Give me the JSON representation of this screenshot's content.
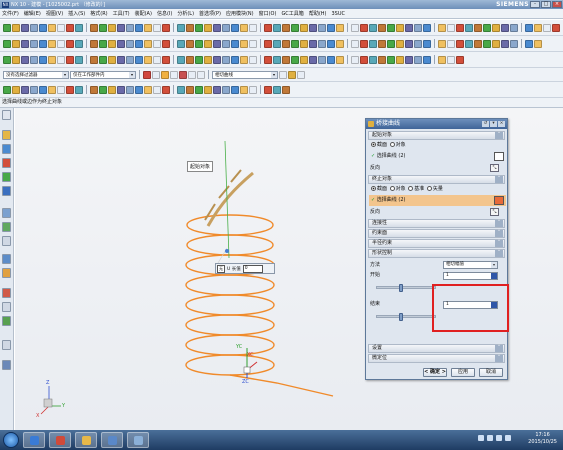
{
  "window": {
    "app_logo": "NX",
    "title": "NX 10 - 建模 - [1025002.prt （修改的）]",
    "brand": "SIEMENS",
    "buttons": [
      "-",
      "□",
      "×"
    ]
  },
  "menu": [
    "文件(F)",
    "编辑(E)",
    "视图(V)",
    "插入(S)",
    "格式(R)",
    "工具(T)",
    "装配(A)",
    "信息(I)",
    "分析(L)",
    "首选项(P)",
    "应用模块(N)",
    "窗口(O)",
    "GC工具箱",
    "帮助(H)",
    "3SUC"
  ],
  "filters": {
    "type_filter": "没有选择过滤器",
    "assembly_filter": "仅在工作部件内",
    "curve_rule": "相切曲线"
  },
  "cue_line": "选择曲线或边作为终止对象",
  "labels": {
    "start_object": "起始对象",
    "end_point": "ZC"
  },
  "graphics": {
    "popup_option": "无",
    "popup_label": "U 长值",
    "popup_value": "0",
    "axis_yc": "YC",
    "axis_xc": "XC",
    "axis_zc": "ZC",
    "triad_z": "Z",
    "triad_y": "Y",
    "triad_x": "X"
  },
  "dialog": {
    "title": "桥接曲线",
    "sections": {
      "start": "起始对象",
      "end": "终止对象",
      "connectivity": "连接性",
      "constraint": "约束面",
      "radius": "半径约束",
      "shape": "形状控制",
      "settings": "设置",
      "preview": "微定位"
    },
    "start_radio_1": "截面",
    "start_radio_2": "对象",
    "start_selected": "选择曲线 (2)",
    "start_reverse": "反向",
    "end_radio_1": "截面",
    "end_radio_2": "对象",
    "end_radio_3": "基准",
    "end_radio_4": "矢量",
    "end_selected": "选择曲线 (2)",
    "end_reverse": "反向",
    "method_label": "方法",
    "method_value": "相切幅值",
    "start_label": "开始",
    "start_value": "1",
    "end_label": "结束",
    "end_value": "1",
    "ok": "< 确定 >",
    "apply": "应用",
    "cancel": "取消"
  },
  "clock": {
    "time": "17:16",
    "date": "2015/10/25"
  }
}
